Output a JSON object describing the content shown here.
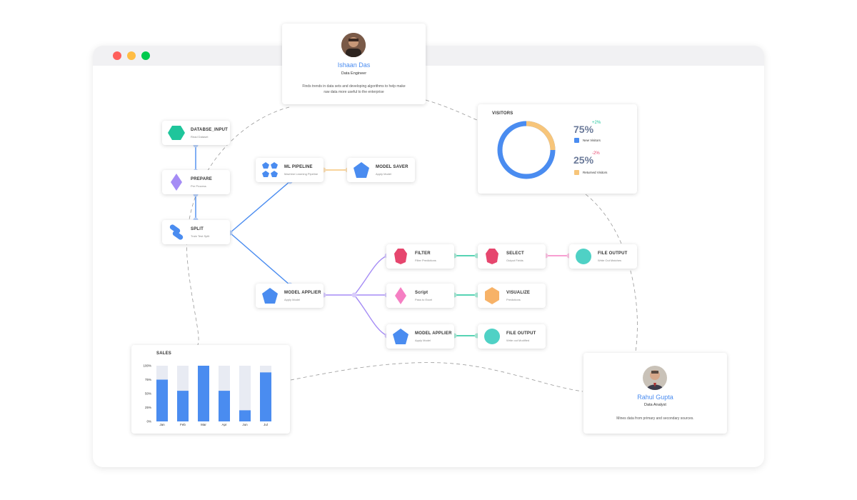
{
  "window": {
    "controls": [
      "close",
      "minimize",
      "maximize"
    ]
  },
  "profiles": {
    "top": {
      "name": "Ishaan Das",
      "role": "Data Engineer",
      "description": "Finds trends in data sets and developing algorithms to help make raw data more useful to the enterprise"
    },
    "bottom": {
      "name": "Rahul Gupta",
      "role": "Data Analyst",
      "description": "Mines data from primary and secondary sources."
    }
  },
  "nodes": {
    "database_input": {
      "title": "DATABSE_INPUT",
      "subtitle": "Read Dataset",
      "color": "#1fc59b",
      "icon": "hexagon-icon"
    },
    "prepare": {
      "title": "PREPARE",
      "subtitle": "Pre Process",
      "color": "#a58cf5",
      "icon": "diamond-icon"
    },
    "split": {
      "title": "SPLIT",
      "subtitle": "Train Test Split",
      "color": "#4a8cf0",
      "icon": "pills-icon"
    },
    "ml_pipeline": {
      "title": "ML PIPELINE",
      "subtitle": "Machine Learning Pipeline",
      "color": "#4a8cf0",
      "icon": "pentagons-icon"
    },
    "model_saver": {
      "title": "MODEL SAVER",
      "subtitle": "Apply Model",
      "color": "#4a8cf0",
      "icon": "pentagon-icon"
    },
    "model_applier_main": {
      "title": "MODEL APPLIER",
      "subtitle": "Apply Model",
      "color": "#4a8cf0",
      "icon": "pentagon-icon"
    },
    "filter": {
      "title": "FILTER",
      "subtitle": "Filter Predictions",
      "color": "#e6466e",
      "icon": "octagon-icon"
    },
    "select": {
      "title": "SELECT",
      "subtitle": "Output Fields",
      "color": "#e6466e",
      "icon": "octagon-icon"
    },
    "file_output_1": {
      "title": "FILE OUTPUT",
      "subtitle": "Write Out Matches",
      "color": "#4fd1c5",
      "icon": "circle-icon"
    },
    "script": {
      "title": "Script",
      "subtitle": "Pass to Excel",
      "color": "#f57fc3",
      "icon": "diamond-icon"
    },
    "visualize": {
      "title": "VISUALIZE",
      "subtitle": "Predictions",
      "color": "#f7b267",
      "icon": "hexagon-icon"
    },
    "model_applier_2": {
      "title": "MODEL APPLIER",
      "subtitle": "Apply Model",
      "color": "#4a8cf0",
      "icon": "pentagon-icon"
    },
    "file_output_2": {
      "title": "FILE OUTPUT",
      "subtitle": "Write out Modified",
      "color": "#4fd1c5",
      "icon": "circle-icon"
    }
  },
  "visitors": {
    "title": "VISITORS",
    "new": {
      "pct": "75%",
      "delta": "+2%",
      "label": "New Visitors",
      "value": 75,
      "color": "#4a8cf0",
      "delta_color": "#1fc59b"
    },
    "returned": {
      "pct": "25%",
      "delta": "-2%",
      "label": "Returned Visitors",
      "value": 25,
      "color": "#f7c57a",
      "delta_color": "#e6466e"
    }
  },
  "chart_data": {
    "type": "bar",
    "title": "SALES",
    "categories": [
      "Jan",
      "Feb",
      "Mar",
      "Apr",
      "Jun",
      "Jul"
    ],
    "values": [
      75,
      55,
      100,
      55,
      20,
      88
    ],
    "ylim": [
      0,
      100
    ],
    "yticks": [
      "0%",
      "25%",
      "50%",
      "75%",
      "100%"
    ],
    "bar_color": "#4a8cf0",
    "track_color": "#e8ebf3"
  }
}
